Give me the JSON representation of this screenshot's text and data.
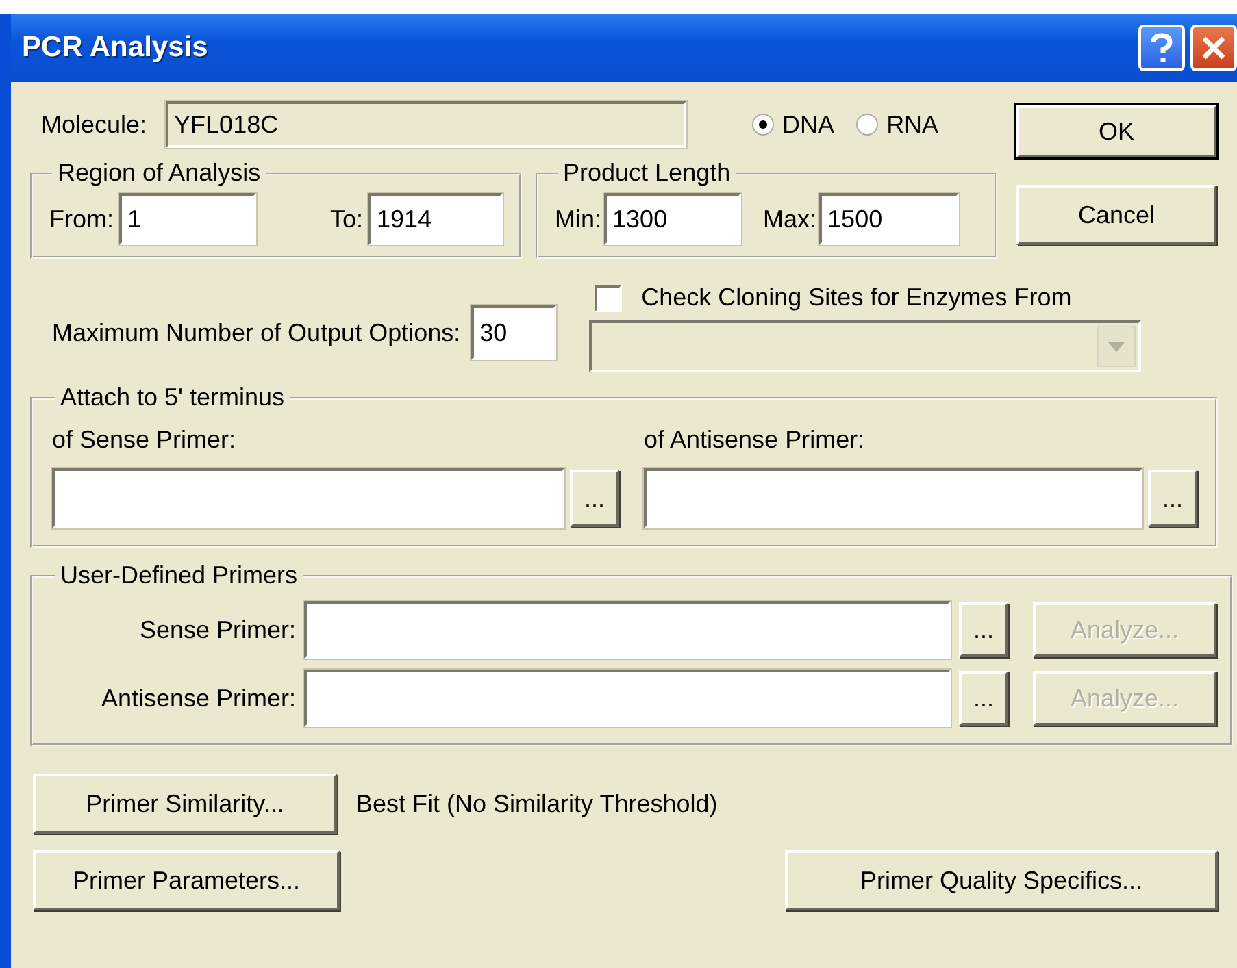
{
  "window": {
    "title": "PCR Analysis"
  },
  "molecule": {
    "label": "Molecule:",
    "value": "YFL018C"
  },
  "molecule_type": [
    {
      "label": "DNA",
      "selected": true
    },
    {
      "label": "RNA",
      "selected": false
    }
  ],
  "buttons": {
    "ok": "OK",
    "cancel": "Cancel"
  },
  "region": {
    "title": "Region of Analysis",
    "from": {
      "label": "From:",
      "value": "1"
    },
    "to": {
      "label": "To:",
      "value": "1914"
    }
  },
  "product_length": {
    "title": "Product Length",
    "min": {
      "label": "Min:",
      "value": "1300"
    },
    "max": {
      "label": "Max:",
      "value": "1500"
    }
  },
  "max_output": {
    "label": "Maximum Number of Output Options:",
    "value": "30"
  },
  "cloning_sites": {
    "label": "Check Cloning Sites for Enzymes From",
    "checked": false,
    "combo_disabled": true
  },
  "attach": {
    "title": "Attach to 5' terminus",
    "fields": [
      {
        "label": "of Sense Primer:",
        "browse": "..."
      },
      {
        "label": "of Antisense Primer:",
        "browse": "..."
      }
    ]
  },
  "user_primers": {
    "title": "User-Defined Primers",
    "rows": [
      {
        "label": "Sense Primer:",
        "browse": "...",
        "analyze": "Analyze...",
        "analyze_disabled": true
      },
      {
        "label": "Antisense Primer:",
        "browse": "...",
        "analyze": "Analyze...",
        "analyze_disabled": true
      }
    ]
  },
  "similarity": {
    "button": "Primer Similarity...",
    "value": "Best Fit (No Similarity Threshold)"
  },
  "parameters_button": "Primer Parameters...",
  "quality_button": "Primer Quality Specifics..."
}
